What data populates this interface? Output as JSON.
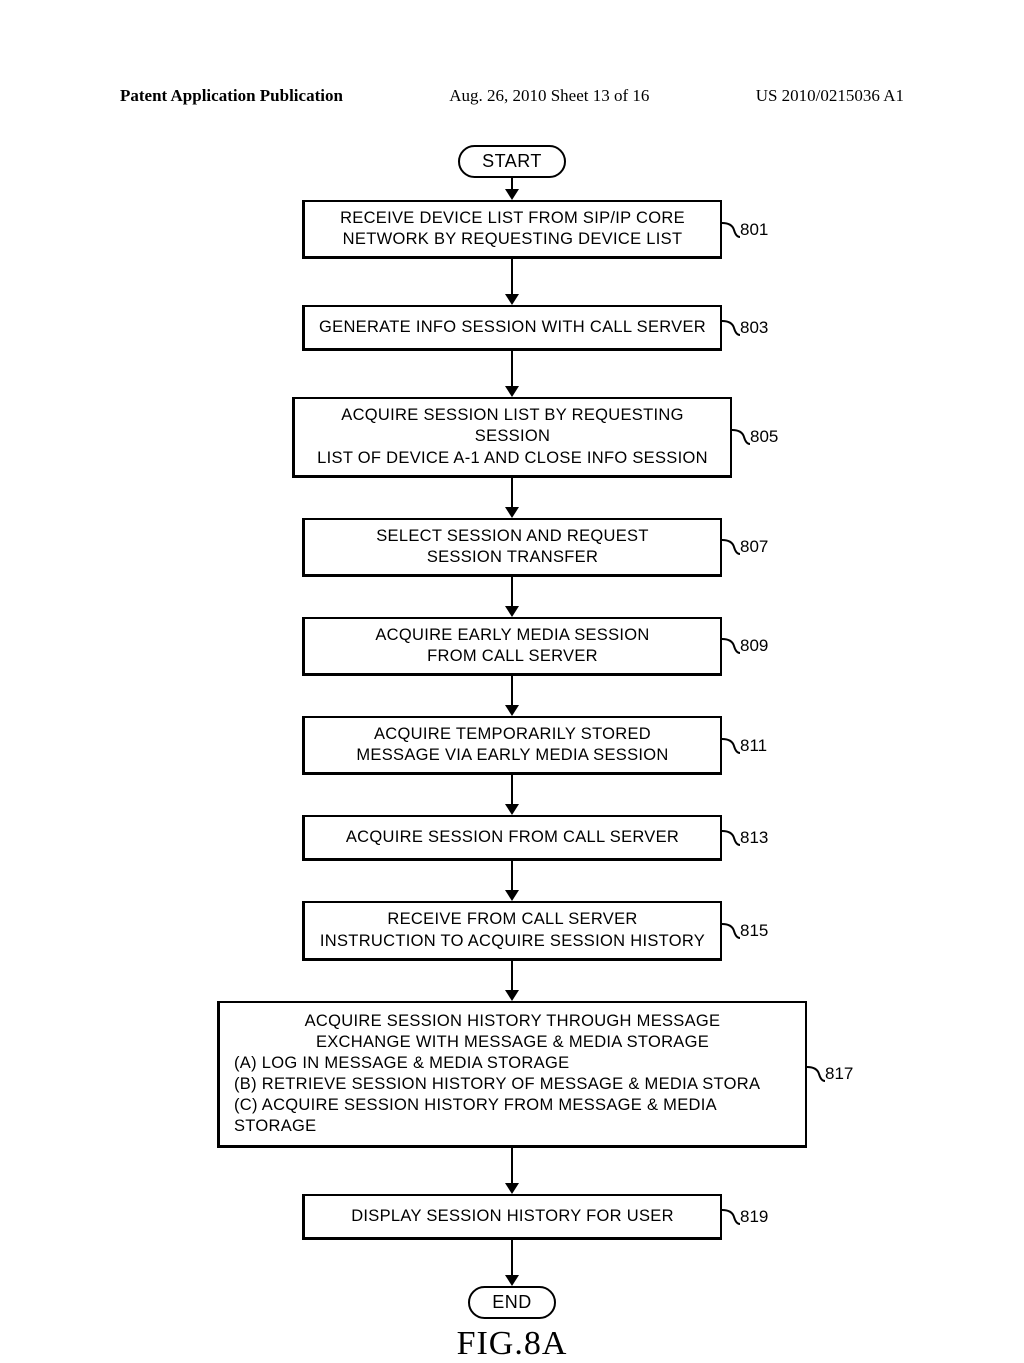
{
  "header": {
    "left": "Patent Application Publication",
    "center": "Aug. 26, 2010  Sheet 13 of 16",
    "right": "US 2010/0215036 A1"
  },
  "flowchart": {
    "start": "START",
    "end": "END",
    "figure": "FIG.8A",
    "steps": [
      {
        "id": "801",
        "text": "RECEIVE DEVICE LIST FROM SIP/IP CORE\nNETWORK BY REQUESTING DEVICE LIST"
      },
      {
        "id": "803",
        "text": "GENERATE INFO SESSION WITH CALL SERVER"
      },
      {
        "id": "805",
        "text": "ACQUIRE SESSION LIST BY REQUESTING SESSION\nLIST OF DEVICE A-1 AND CLOSE INFO SESSION"
      },
      {
        "id": "807",
        "text": "SELECT SESSION AND REQUEST\nSESSION TRANSFER"
      },
      {
        "id": "809",
        "text": "ACQUIRE EARLY MEDIA SESSION\nFROM CALL SERVER"
      },
      {
        "id": "811",
        "text": "ACQUIRE TEMPORARILY STORED\nMESSAGE VIA EARLY MEDIA SESSION"
      },
      {
        "id": "813",
        "text": "ACQUIRE SESSION FROM CALL SERVER"
      },
      {
        "id": "815",
        "text": "RECEIVE FROM CALL SERVER\nINSTRUCTION TO ACQUIRE SESSION HISTORY"
      },
      {
        "id": "817",
        "text": "ACQUIRE SESSION HISTORY THROUGH MESSAGE\nEXCHANGE WITH MESSAGE & MEDIA STORAGE\n(A) LOG IN MESSAGE & MEDIA STORAGE\n(B) RETRIEVE SESSION HISTORY OF MESSAGE & MEDIA STORA\n(C) ACQUIRE SESSION HISTORY FROM MESSAGE & MEDIA STORAGE",
        "wide": true
      },
      {
        "id": "819",
        "text": "DISPLAY SESSION HISTORY FOR USER"
      }
    ]
  }
}
